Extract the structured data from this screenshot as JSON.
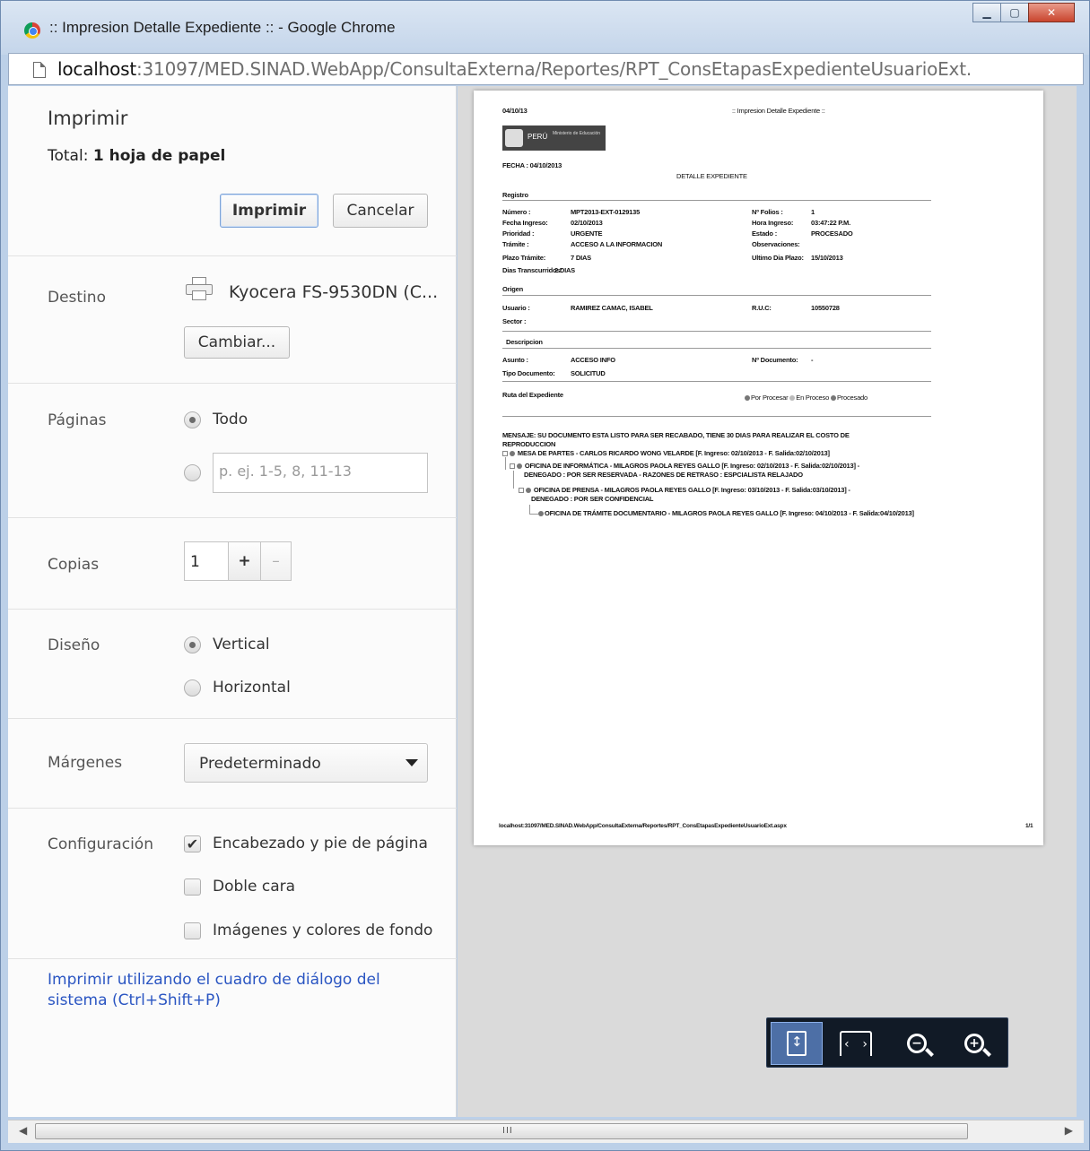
{
  "window": {
    "title": ":: Impresion Detalle Expediente :: - Google Chrome",
    "url_host": "localhost",
    "url_path": ":31097/MED.SINAD.WebApp/ConsultaExterna/Reportes/RPT_ConsEtapasExpedienteUsuarioExt."
  },
  "sidebar": {
    "title": "Imprimir",
    "total_label": "Total: ",
    "total_value": "1 hoja de papel",
    "print_button": "Imprimir",
    "cancel_button": "Cancelar",
    "destination": {
      "label": "Destino",
      "printer": "Kyocera FS-9530DN (C...",
      "change_button": "Cambiar..."
    },
    "pages": {
      "label": "Páginas",
      "all": "Todo",
      "all_selected": true,
      "range_placeholder": "p. ej. 1-5, 8, 11-13"
    },
    "copies": {
      "label": "Copias",
      "value": "1",
      "plus": "+",
      "minus": "–"
    },
    "layout": {
      "label": "Diseño",
      "portrait": "Vertical",
      "landscape": "Horizontal",
      "selected": "Vertical"
    },
    "margins": {
      "label": "Márgenes",
      "value": "Predeterminado"
    },
    "settings": {
      "label": "Configuración",
      "headers_footers": "Encabezado y pie de página",
      "headers_footers_checked": true,
      "two_sided": "Doble cara",
      "two_sided_checked": false,
      "background": "Imágenes y colores de fondo",
      "background_checked": false
    },
    "system_dialog_link": "Imprimir utilizando el cuadro de diálogo del sistema (Ctrl+Shift+P)"
  },
  "preview": {
    "header_date": "04/10/13",
    "header_title": ":: Impresion Detalle Expediente ::",
    "logo_country": "PERÚ",
    "logo_ministry": "Ministerio de Educación",
    "fecha": "FECHA : 04/10/2013",
    "doc_title": "DETALLE EXPEDIENTE",
    "sec_registro": "Registro",
    "registro": [
      {
        "k": "Número :",
        "v": "MPT2013-EXT-0129135",
        "k2": "Nº Folios :",
        "v2": "1"
      },
      {
        "k": "Fecha Ingreso:",
        "v": "02/10/2013",
        "k2": "Hora Ingreso:",
        "v2": "03:47:22 P.M."
      },
      {
        "k": "Prioridad :",
        "v": "URGENTE",
        "k2": "Estado :",
        "v2": "PROCESADO"
      },
      {
        "k": "Trámite :",
        "v": "ACCESO A LA INFORMACION",
        "k2": "Observaciones:",
        "v2": ""
      },
      {
        "k": "Plazo Trámite:",
        "v": "7 DIAS",
        "k2": "Ultimo Dia Plazo:",
        "v2": "15/10/2013"
      },
      {
        "k": "Dias Transcurridos:",
        "v": "2 DIAS",
        "k2": "",
        "v2": ""
      }
    ],
    "sec_origen": "Origen",
    "usuario_k": "Usuario :",
    "usuario_v": "RAMIREZ CAMAC, ISABEL",
    "ruc_k": "R.U.C:",
    "ruc_v": "10550728",
    "sector_k": "Sector :",
    "sec_descripcion": "Descripcion",
    "asunto_k": "Asunto :",
    "asunto_v": "ACCESO INFO",
    "ndoc_k": "Nº Documento:",
    "ndoc_v": "-",
    "tipo_k": "Tipo Documento:",
    "tipo_v": "SOLICITUD",
    "ruta": "Ruta del Expediente",
    "legend_1": "Por Procesar",
    "legend_2": "En Proceso",
    "legend_3": "Procesado",
    "mensaje_1": "MENSAJE: SU DOCUMENTO ESTA LISTO PARA SER RECABADO, TIENE 30 DIAS PARA REALIZAR EL COSTO DE",
    "mensaje_2": "REPRODUCCION",
    "tree": [
      "MESA DE PARTES - CARLOS RICARDO WONG VELARDE [F. Ingreso: 02/10/2013 - F. Salida:02/10/2013]",
      "OFICINA DE INFORMÁTICA - MILAGROS PAOLA REYES GALLO [F. Ingreso: 02/10/2013 - F. Salida:02/10/2013] -",
      "DENEGADO : POR SER RESERVADA - RAZONES DE RETRASO : ESPCIALISTA RELAJADO",
      "OFICINA DE PRENSA - MILAGROS PAOLA REYES GALLO [F. Ingreso: 03/10/2013 - F. Salida:03/10/2013] -",
      "DENEGADO : POR SER CONFIDENCIAL",
      "OFICINA DE TRÁMITE DOCUMENTARIO - MILAGROS PAOLA REYES GALLO [F. Ingreso: 04/10/2013 - F. Salida:04/10/2013]"
    ],
    "footer_url": "localhost:31097/MED.SINAD.WebApp/ConsultaExterna/Reportes/RPT_ConsEtapasExpedienteUsuarioExt.aspx",
    "footer_page": "1/1"
  },
  "zoom": {
    "fit_page": "fit-to-page-icon",
    "fit_width": "fit-to-width-icon",
    "zoom_out": "zoom-out-icon",
    "zoom_in": "zoom-in-icon",
    "minus": "−",
    "plus": "+",
    "width_left": "‹",
    "width_right": "›"
  },
  "scrollbar": {
    "left_arrow": "◀",
    "right_arrow": "▶",
    "grip": "III"
  }
}
